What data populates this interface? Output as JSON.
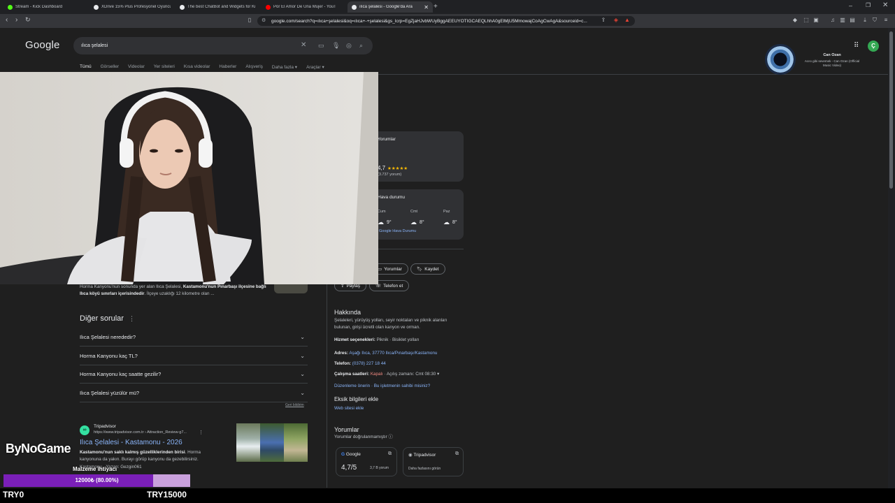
{
  "tabs": [
    {
      "title": "Stream - Kick Dashboard",
      "color": "#53fc18"
    },
    {
      "title": "XDrive 15% Plus Profesyonel Oyuncu",
      "color": "#e8eaed"
    },
    {
      "title": "The best ChatBot and Widgets for Ki",
      "color": "#e8eaed"
    },
    {
      "title": "Por El Amor De Una Mujer - YouT",
      "color": "#ff0000"
    },
    {
      "title": "ılıca şelalesi - Google'da Ara",
      "color": "#e8eaed"
    }
  ],
  "new_tab": "+",
  "address": "google.com/search?q=ılıca+şelalesi&oq=ılıca+-+şelalesi&gs_lcrp=EgZjaHJvbWUyBggAEEUYOTIGCAEQLhhA0gElMjU5MmowajCoAgCwAgA&sourceid=c...",
  "google": {
    "logo": "Google",
    "query": "ılıca şelalesi",
    "tabs": [
      "Tümü",
      "Görseller",
      "Videolar",
      "Yer siteleri",
      "Kısa videolar",
      "Haberler",
      "Alışveriş",
      "Daha fazla ▾",
      "Araçlar ▾"
    ]
  },
  "profile": {
    "name": "Can Ozan",
    "sub": "Acısı gibi sevemek - Can Ozan (Official Music Video)",
    "avatar_letter": "Ç"
  },
  "panel": {
    "reviews_label": "Yorumlar",
    "rating": "4,7",
    "stars": "★★★★★",
    "reviews_count": "(3.737 yorum)",
    "weather_title": "Hava durumu",
    "weather": [
      {
        "day": "Cum",
        "temp": "9°"
      },
      {
        "day": "Cmt",
        "temp": "8°"
      },
      {
        "day": "Paz",
        "temp": "8°"
      }
    ],
    "weather_link": "Google Hava Durumu",
    "actions": [
      "Yorumlar",
      "Kaydet",
      "Paylaş",
      "Telefon et"
    ],
    "about_title": "Hakkında",
    "about_text": "Şelaleleri, yürüyüş yolları, seyir noktaları ve piknik alanları bulunan, girişi ücretli olan kanyon ve orman.",
    "service_label": "Hizmet seçenekleri:",
    "service_value": "Piknik · Bisiklet yolları",
    "address_label": "Adres:",
    "address_value": "Aşağı Ilıca, 37770 Ilıca/Pınarbaşı/Kastamonu",
    "phone_label": "Telefon:",
    "phone_value": "(0378) 227 18 44",
    "hours_label": "Çalışma saatleri:",
    "hours_closed": "Kapalı",
    "hours_rest": " · Açılış zamanı: Cmt 08:30 ▾",
    "suggest": "Düzenleme önerin · Bu işletmenin sahibi misiniz?",
    "missing_title": "Eksik bilgileri ekle",
    "missing_link": "Web sitesi ekle",
    "reviews_title": "Yorumlar",
    "reviews_note": "Yorumlar doğrulanmamıştır ⓘ",
    "google_label": "Google",
    "google_score": "4,7/5",
    "google_count": "3,7 B yorum",
    "ta_label": "Tripadvisor",
    "ta_text": "Daha fazlasını görün"
  },
  "results": {
    "snippet_a": "Horma Kanyonu'nun sonunda yer alan Ilıca Şelalesi, ",
    "snippet_b": "Kastamonu'nun Pınarbaşı ilçesine bağlı Ilıca köyü sınırları içerisindedir",
    "snippet_c": ". İlçeye uzaklığı 12 kilometre olan ...",
    "faq_title": "Diğer sorular",
    "faq": [
      "Ilıca Şelalesi nerededir?",
      "Horma Kanyonu kaç TL?",
      "Horma Kanyonu kaç saatte gezilir?",
      "Ilıca Şelalesi yüzülür mü?"
    ],
    "feedback": "Geri bildirim",
    "ta_site": "Tripadvisor",
    "ta_url": "https://www.tripadvisor.com.tr › Attraction_Review-g7...",
    "ta_title": "Ilıca Şelalesi - Kastamonu - 2026",
    "ta_desc_bold": "Kastamonu'nun saklı kalmış güzelliklerinden birisi",
    "ta_desc": ". Horma kanyonuna da yakın. Burayı görüp kanyonu da gezebilirsiniz.",
    "ta_author": "Kastamonu · Yazan: Gezgin061"
  },
  "overlay": {
    "brand": "ByNoGame",
    "goal_title": "Malzeme ihtiyacı",
    "goal_text": "12000₺ (80.00%)",
    "goal_progress": 0.8,
    "min": "TRY0",
    "max": "TRY15000"
  }
}
